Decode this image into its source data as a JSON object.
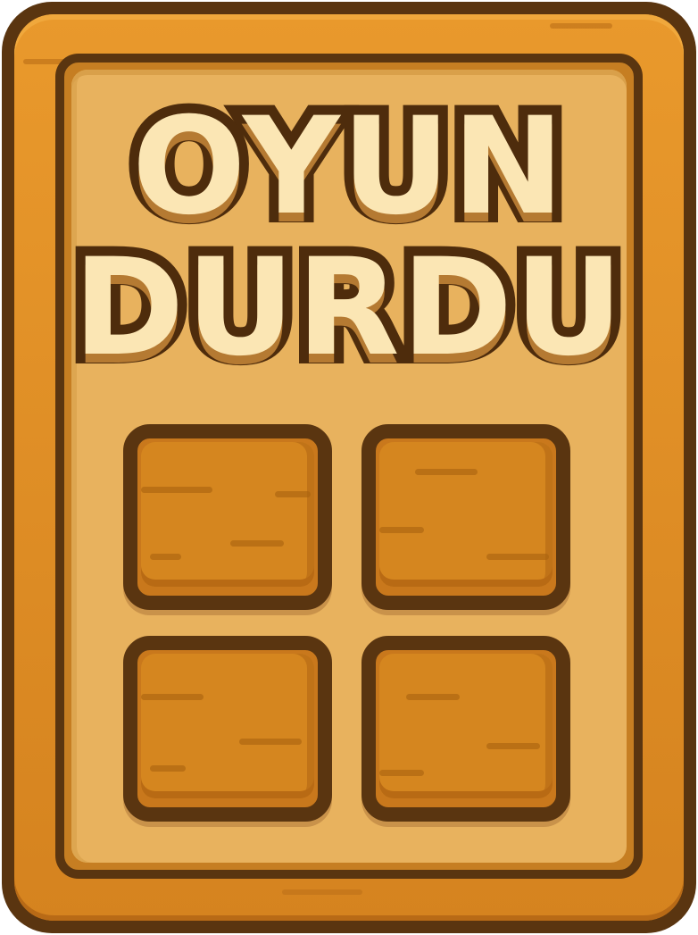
{
  "pause_menu": {
    "title_line1": "OYUN",
    "title_line2": "DURDU",
    "buttons": [
      {
        "label": ""
      },
      {
        "label": ""
      },
      {
        "label": ""
      },
      {
        "label": ""
      }
    ]
  },
  "colors": {
    "frame_dark": "#5a3510",
    "wood": "#d88a25",
    "panel": "#e8b25e",
    "title_fill": "#fbe6b4"
  }
}
